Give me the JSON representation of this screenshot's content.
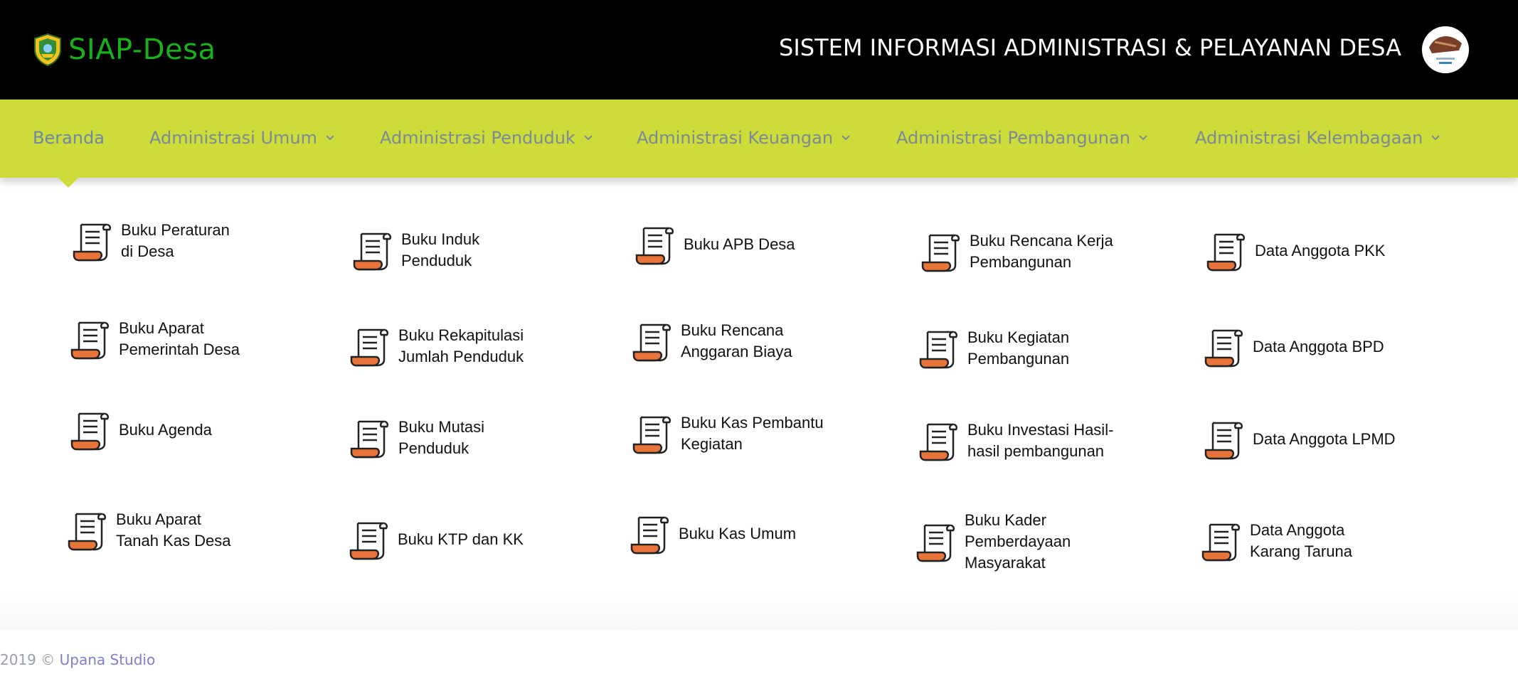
{
  "header": {
    "brand": "SIAP-Desa",
    "system_title": "SISTEM INFORMASI ADMINISTRASI & PELAYANAN DESA"
  },
  "nav": {
    "items": [
      {
        "label": "Beranda",
        "active": true
      },
      {
        "label": "Administrasi Umum"
      },
      {
        "label": "Administrasi Penduduk"
      },
      {
        "label": "Administrasi Keuangan"
      },
      {
        "label": "Administrasi Pembangunan"
      },
      {
        "label": "Administrasi Kelembagaan"
      }
    ]
  },
  "menu": {
    "col1": [
      {
        "label": "Buku Peraturan\ndi Desa"
      },
      {
        "label": "Buku Aparat\nPemerintah Desa"
      },
      {
        "label": "Buku Agenda"
      },
      {
        "label": "Buku Aparat\nTanah Kas Desa"
      }
    ],
    "col2": [
      {
        "label": "Buku Induk\nPenduduk"
      },
      {
        "label": "Buku Rekapitulasi\nJumlah Penduduk"
      },
      {
        "label": "Buku Mutasi\nPenduduk"
      },
      {
        "label": "Buku KTP dan KK"
      }
    ],
    "col3": [
      {
        "label": "Buku APB Desa"
      },
      {
        "label": "Buku Rencana\nAnggaran Biaya"
      },
      {
        "label": "Buku Kas Pembantu\nKegiatan"
      },
      {
        "label": "Buku Kas Umum"
      }
    ],
    "col4": [
      {
        "label": "Buku Rencana  Kerja\nPembangunan"
      },
      {
        "label": "Buku Kegiatan\nPembangunan"
      },
      {
        "label": "Buku Investasi Hasil-\nhasil pembangunan"
      },
      {
        "label": "Buku Kader\nPemberdayaan\nMasyarakat"
      }
    ],
    "col5": [
      {
        "label": "Data Anggota PKK"
      },
      {
        "label": "Data Anggota BPD"
      },
      {
        "label": "Data Anggota LPMD"
      },
      {
        "label": "Data Anggota\nKarang Taruna"
      }
    ]
  },
  "footer": {
    "copyright": "2019 © ",
    "studio": "Upana Studio"
  },
  "colors": {
    "header_bg": "#000000",
    "nav_bg": "#cddc39",
    "brand_green": "#18b01b",
    "icon_orange": "#e8743b"
  },
  "icons": {
    "document": "scroll-document-icon",
    "nav_dropdown": "chevron-down-icon"
  }
}
